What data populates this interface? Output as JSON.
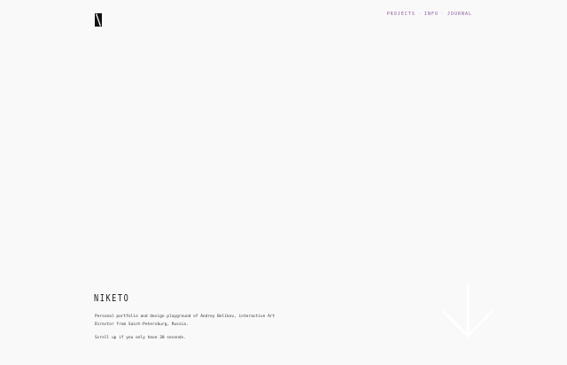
{
  "header": {
    "logo_icon": "niketo-logo-icon",
    "nav": {
      "projects_label": "PROJECTS",
      "info_label": "INFO",
      "journal_label": "JOURNAL",
      "separator": "·"
    }
  },
  "hero": {
    "brand": "NIKETO",
    "bio": "Personal portfolio and design playground of Andrey Belikov, interactive Art Director from Saint-Petersburg, Russia.",
    "tip": "Scroll up if you only have 30 seconds.",
    "arrow_icon": "arrow-down-icon"
  },
  "colors": {
    "background": "#f9f9f9",
    "nav_accent": "#8a5a9e",
    "text": "#222222",
    "arrow": "#ffffff"
  }
}
